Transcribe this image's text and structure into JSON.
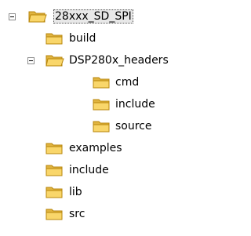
{
  "tree": {
    "nodes": [
      {
        "label": "28xxx_SD_SPI",
        "expanded": true,
        "selected": true,
        "icon": "folder-icon"
      },
      {
        "label": "build",
        "icon": "folder-icon"
      },
      {
        "label": "DSP280x_headers",
        "expanded": true,
        "icon": "folder-icon"
      },
      {
        "label": "cmd",
        "icon": "folder-icon"
      },
      {
        "label": "include",
        "icon": "folder-icon"
      },
      {
        "label": "source",
        "icon": "folder-icon"
      },
      {
        "label": "examples",
        "icon": "folder-icon"
      },
      {
        "label": "include",
        "icon": "folder-icon"
      },
      {
        "label": "lib",
        "icon": "folder-icon"
      },
      {
        "label": "src",
        "icon": "folder-icon"
      }
    ]
  },
  "colors": {
    "folder_body": "#f2c94c",
    "folder_top": "#fbe08a",
    "folder_outline": "#b8860b",
    "selection_bg": "#e8e8e8"
  }
}
